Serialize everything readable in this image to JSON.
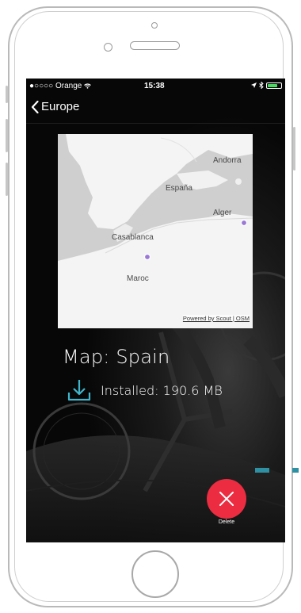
{
  "status_bar": {
    "carrier": "Orange",
    "time": "15:38"
  },
  "nav": {
    "back_label": "Europe"
  },
  "map": {
    "labels": {
      "andorra": "Andorra",
      "espana": "España",
      "alger": "Alger",
      "casablanca": "Casablanca",
      "maroc": "Maroc"
    },
    "attribution": "Powered by Scout | OSM"
  },
  "detail": {
    "title": "Map: Spain",
    "installed": "Installed: 190.6 MB"
  },
  "actions": {
    "delete_label": "Delete"
  },
  "colors": {
    "accent_cyan": "#3fb6cc",
    "delete_red": "#ec2c40",
    "battery_green": "#4cd964",
    "map_marker": "#9a78d6"
  },
  "icons": {
    "back": "chevron-left-icon",
    "download": "download-icon",
    "close": "close-icon",
    "wifi": "wifi-icon",
    "bluetooth": "bluetooth-icon",
    "location": "location-arrow-icon",
    "battery": "battery-icon"
  }
}
